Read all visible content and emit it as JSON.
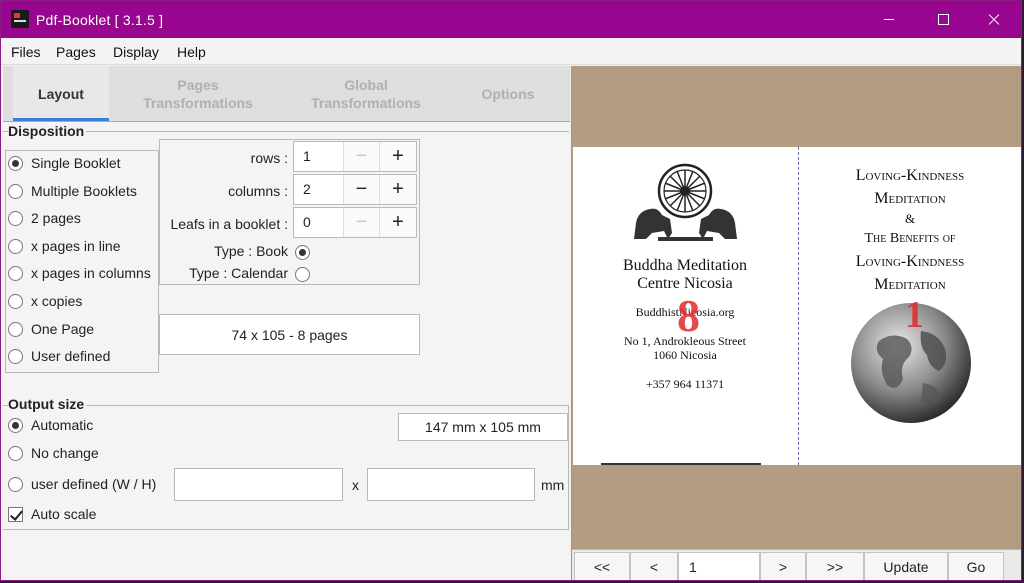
{
  "window": {
    "title": "Pdf-Booklet  [ 3.1.5 ]"
  },
  "menu": [
    "Files",
    "Pages",
    "Display",
    "Help"
  ],
  "tabs": [
    {
      "label": "Layout",
      "active": true
    },
    {
      "label": "Pages\nTransformations",
      "active": false
    },
    {
      "label": "Global\nTransformations",
      "active": false
    },
    {
      "label": "Options",
      "active": false
    }
  ],
  "disposition": {
    "title": "Disposition",
    "options": [
      {
        "label": "Single Booklet",
        "selected": true
      },
      {
        "label": "Multiple Booklets",
        "selected": false
      },
      {
        "label": "2 pages",
        "selected": false
      },
      {
        "label": "x pages in line",
        "selected": false
      },
      {
        "label": "x pages in columns",
        "selected": false
      },
      {
        "label": "x copies",
        "selected": false
      },
      {
        "label": "One Page",
        "selected": false
      },
      {
        "label": "User defined",
        "selected": false
      }
    ],
    "rows_label": "rows :",
    "rows_value": "1",
    "columns_label": "columns :",
    "columns_value": "2",
    "leafs_label": "Leafs in a booklet :",
    "leafs_value": "0",
    "type_book": "Type : Book",
    "type_calendar": "Type : Calendar",
    "summary": "74 x 105 - 8 pages"
  },
  "output": {
    "title": "Output size",
    "automatic": "Automatic",
    "no_change": "No change",
    "user_defined": "user defined (W / H)",
    "auto_scale": "Auto scale",
    "size_display": "147 mm x 105 mm",
    "x_label": "x",
    "unit": "mm"
  },
  "preview": {
    "left_page": {
      "line1": "Buddha Meditation",
      "line2": "Centre Nicosia",
      "url": "BuddhistNicosia.org",
      "addr1": "No 1, Androkleous Street",
      "addr2": "1060 Nicosia",
      "phone": "+357 964 11371",
      "number": "8"
    },
    "right_page": {
      "t1": "Loving-Kindness",
      "t2": "Meditation",
      "t3": "&",
      "t4": "The Benefits of",
      "t5": "Loving-Kindness",
      "t6": "Meditation",
      "number": "1"
    }
  },
  "nav": {
    "first": "<<",
    "prev": "<",
    "page": "1",
    "next": ">",
    "last": ">>",
    "update": "Update",
    "go": "Go"
  }
}
